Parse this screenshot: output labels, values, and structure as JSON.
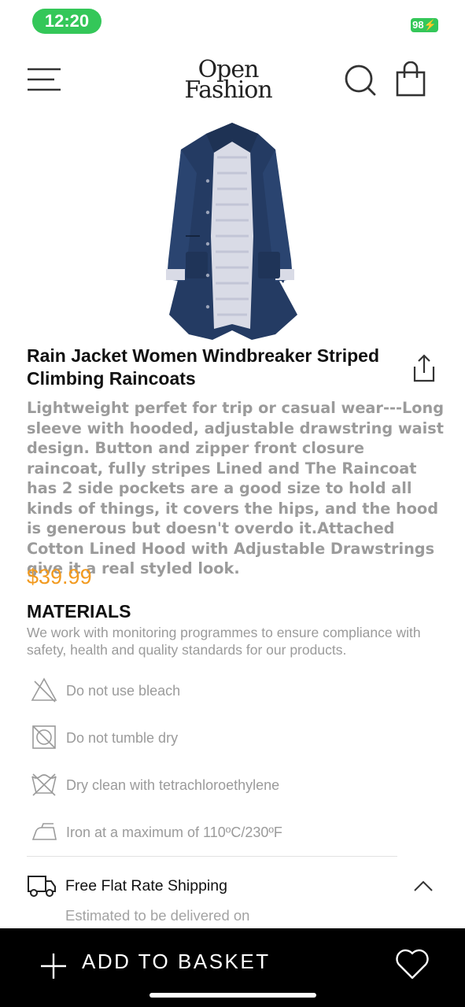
{
  "status": {
    "time": "12:20",
    "battery": "98"
  },
  "header": {
    "logo_line1": "Open",
    "logo_line2": "Fashion",
    "icons": [
      "menu-icon",
      "search-icon",
      "shopping-bag-icon"
    ]
  },
  "product": {
    "image": "navy-rain-jacket",
    "title": "Rain Jacket Women Windbreaker Striped Climbing Raincoats",
    "description": "Lightweight perfet for trip or casual wear---Long sleeve with hooded, adjustable drawstring waist design. Button and zipper front closure raincoat, fully stripes Lined and The Raincoat has 2 side pockets are a good size to hold all kinds of things, it covers the hips, and the hood is generous but doesn't overdo it.Attached Cotton Lined Hood with Adjustable Drawstrings give it a real styled look.",
    "price": "$39.99",
    "price_color": "#f29a1f"
  },
  "materials": {
    "title": "MATERIALS",
    "description": "We work with monitoring programmes to ensure compliance with safety, health and quality standards for our products.",
    "care": [
      {
        "icon": "no-bleach-icon",
        "label": "Do not use bleach"
      },
      {
        "icon": "no-tumble-dry-icon",
        "label": "Do not tumble dry"
      },
      {
        "icon": "dry-clean-icon",
        "label": "Dry clean with tetrachloroethylene"
      },
      {
        "icon": "iron-icon",
        "label": "Iron at a maximum of 110ºC/230ºF"
      }
    ]
  },
  "shipping": {
    "title": "Free Flat Rate Shipping",
    "subtitle": "Estimated to be delivered on"
  },
  "bottom_bar": {
    "add_label": "ADD TO BASKET"
  }
}
